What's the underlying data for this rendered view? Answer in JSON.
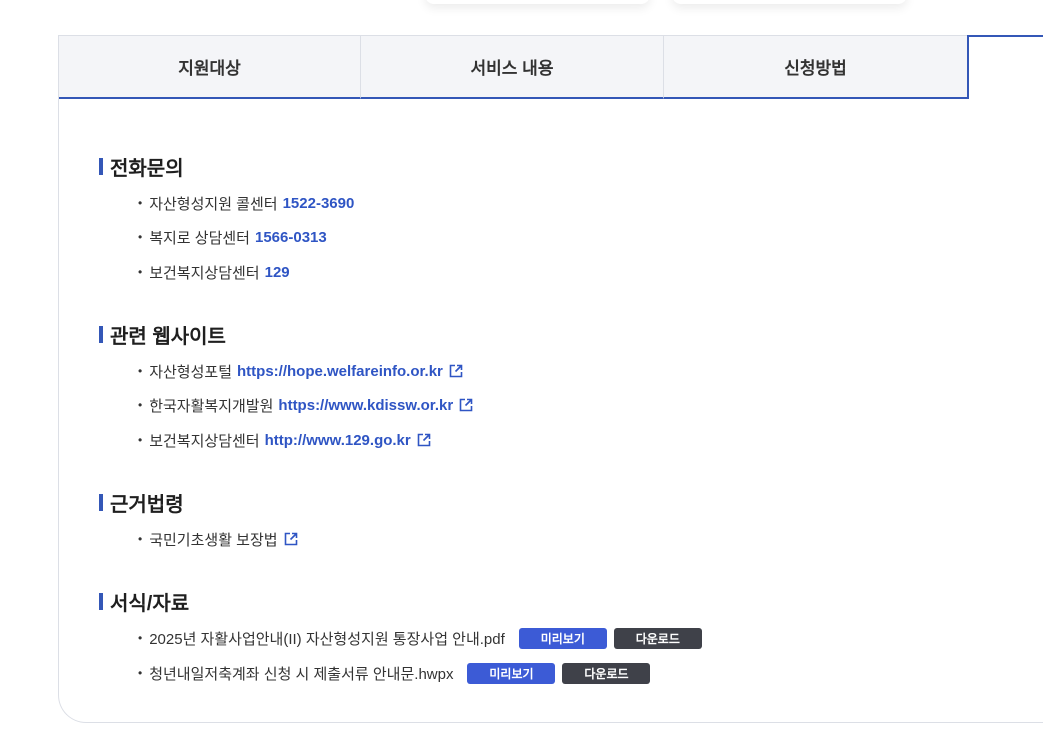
{
  "tabs": [
    "지원대상",
    "서비스 내용",
    "신청방법",
    ""
  ],
  "sections": {
    "phone": {
      "title": "전화문의",
      "items": [
        {
          "label": "자산형성지원 콜센터",
          "value": "1522-3690"
        },
        {
          "label": "복지로 상담센터",
          "value": "1566-0313"
        },
        {
          "label": "보건복지상담센터",
          "value": "129"
        }
      ]
    },
    "websites": {
      "title": "관련 웹사이트",
      "items": [
        {
          "label": "자산형성포털",
          "url": "https://hope.welfareinfo.or.kr"
        },
        {
          "label": "한국자활복지개발원",
          "url": "https://www.kdissw.or.kr"
        },
        {
          "label": "보건복지상담센터",
          "url": "http://www.129.go.kr"
        }
      ]
    },
    "law": {
      "title": "근거법령",
      "items": [
        {
          "label": "국민기초생활 보장법"
        }
      ]
    },
    "forms": {
      "title": "서식/자료",
      "preview_label": "미리보기",
      "download_label": "다운로드",
      "items": [
        {
          "label": "2025년 자활사업안내(II) 자산형성지원 통장사업 안내.pdf"
        },
        {
          "label": "청년내일저축계좌 신청 시 제출서류 안내문.hwpx"
        }
      ]
    }
  },
  "colors": {
    "accent": "#3457b7",
    "link": "#2f55c4",
    "preview_btn": "#3c5bd6",
    "download_btn": "#3f4149"
  },
  "icons": {
    "external_link": "external-link-icon"
  }
}
